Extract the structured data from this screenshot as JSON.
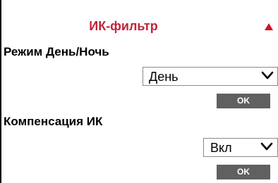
{
  "panel": {
    "title": "ИК-фильтр",
    "collapse_icon": "triangle-up-icon",
    "accent_color": "#c0243a"
  },
  "day_night": {
    "label": "Режим День/Ночь",
    "selected": "День",
    "ok_label": "OK"
  },
  "ir_compensation": {
    "label": "Компенсация ИК",
    "selected": "Вкл",
    "ok_label": "OK"
  }
}
